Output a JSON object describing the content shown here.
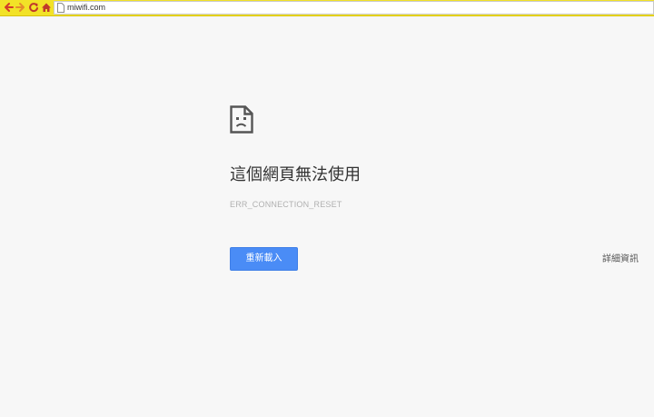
{
  "browser": {
    "address_bar": {
      "url": "miwifi.com"
    },
    "colors": {
      "toolbar_background": "#f2e227",
      "back_arrow": "#d43b2a",
      "forward_arrow": "#e58c2a",
      "reload_icon": "#c0392b",
      "home_icon": "#c0392b"
    }
  },
  "error_page": {
    "icon": "sad-tab-icon",
    "heading": "這個網頁無法使用",
    "error_code": "ERR_CONNECTION_RESET",
    "reload_label": "重新載入",
    "details_label": "詳細資訊",
    "colors": {
      "page_background": "#f7f7f7",
      "reload_button": "#4a8cf6",
      "heading_text": "#333333",
      "error_code_text": "#b0b0b0"
    }
  }
}
